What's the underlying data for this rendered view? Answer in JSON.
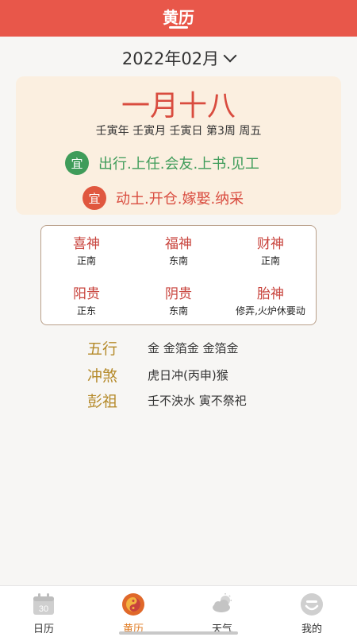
{
  "header": {
    "title": "黄历"
  },
  "date_selector": {
    "label": "2022年02月",
    "icon": "chevron-down-icon"
  },
  "card": {
    "lunar_date": "一月十八",
    "ganzhi_line": "壬寅年 壬寅月 壬寅日  第3周 周五",
    "yi": {
      "badge": "宜",
      "text": "出行.上任.会友.上书.见工",
      "color": "#3f9c5a",
      "text_color": "#3f9c5a"
    },
    "ji": {
      "badge": "宜",
      "text": "动土.开仓.嫁娶.纳采",
      "color": "#e0573f",
      "text_color": "#d94c3f"
    }
  },
  "gods": [
    {
      "name": "喜神",
      "direction": "正南"
    },
    {
      "name": "福神",
      "direction": "东南"
    },
    {
      "name": "财神",
      "direction": "正南"
    },
    {
      "name": "阳贵",
      "direction": "正东"
    },
    {
      "name": "阴贵",
      "direction": "东南"
    },
    {
      "name": "胎神",
      "direction": "修弄,火炉休要动"
    }
  ],
  "info": [
    {
      "label": "五行",
      "value": "金 金箔金 金箔金"
    },
    {
      "label": "冲煞",
      "value": "虎日冲(丙申)猴"
    },
    {
      "label": "彭祖",
      "value": "壬不泱水 寅不祭祀"
    }
  ],
  "nav": [
    {
      "label": "日历",
      "icon": "calendar-icon",
      "badge": "30",
      "active": false
    },
    {
      "label": "黄历",
      "icon": "yin-yang-icon",
      "active": true
    },
    {
      "label": "天气",
      "icon": "weather-icon",
      "active": false
    },
    {
      "label": "我的",
      "icon": "profile-icon",
      "active": false
    }
  ],
  "colors": {
    "primary": "#e8574a",
    "accent_orange": "#e07b22",
    "gold": "#b58a2a"
  }
}
